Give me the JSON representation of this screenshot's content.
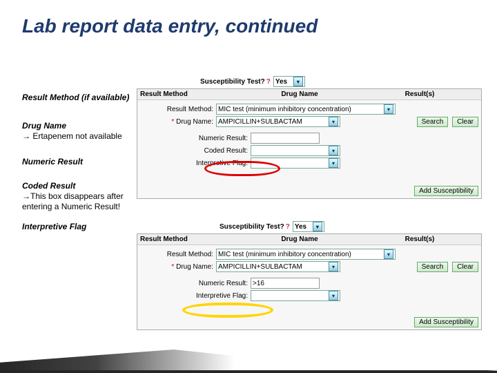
{
  "title": "Lab report data entry, continued",
  "left": {
    "resultMethod": "Result Method (if available)",
    "drugName": "Drug Name",
    "drugNote": "→ Ertapenem not available",
    "numericResult": "Numeric Result",
    "codedResult": "Coded Result",
    "codedNote": "→This box disappears after entering a Numeric Result!",
    "interpretiveFlag": "Interpretive Flag"
  },
  "panel": {
    "cols": {
      "rm": "Result Method",
      "dn": "Drug Name",
      "rs": "Result(s)"
    },
    "labels": {
      "resultMethod": "Result Method:",
      "drugName": "Drug Name:",
      "numericResult": "Numeric Result:",
      "codedResult": "Coded Result:",
      "interpretiveFlag": "Interpretive Flag:"
    },
    "values": {
      "resultMethodSel": "MIC test (minimum inhibitory concentration)",
      "drugSel": "AMPICILLIN+SULBACTAM",
      "numeric1": "",
      "numeric2": ">16"
    },
    "btns": {
      "search": "Search",
      "clear": "Clear",
      "add": "Add Susceptibility"
    }
  },
  "susc": {
    "label": "Susceptibility Test?",
    "value": "Yes"
  }
}
